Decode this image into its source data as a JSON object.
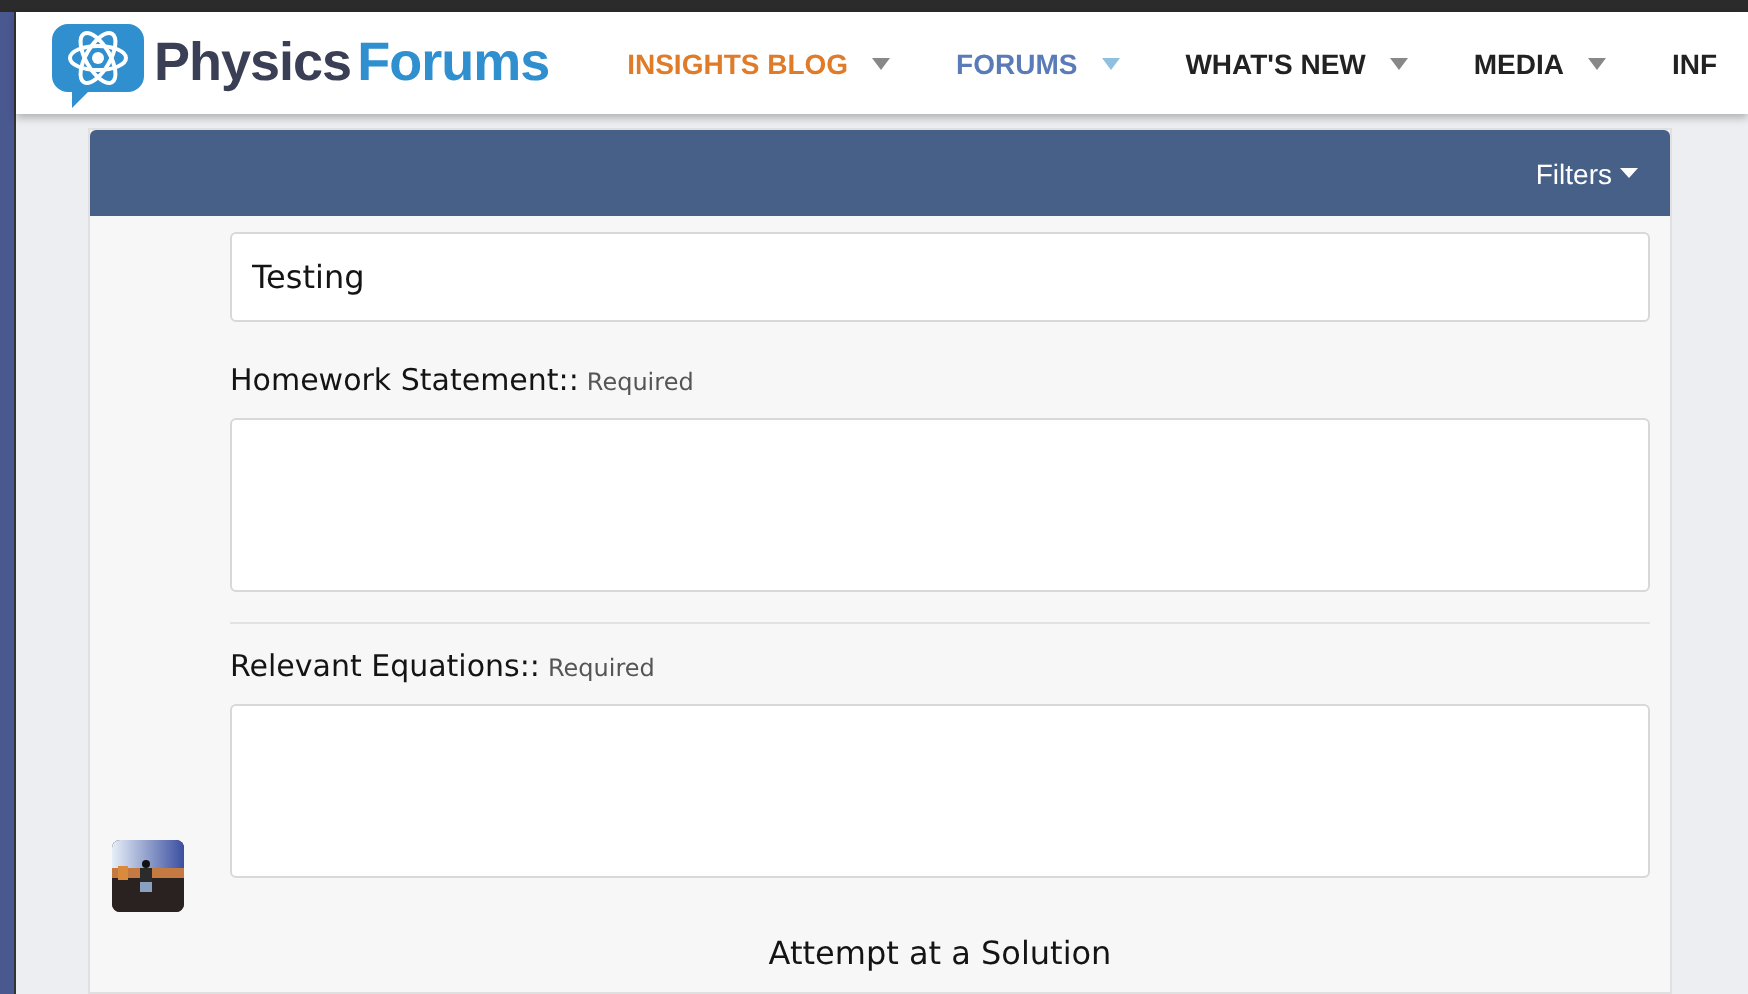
{
  "header": {
    "logo": {
      "word_1": "Physics",
      "word_2": "Forums"
    },
    "nav": [
      {
        "label": "INSIGHTS BLOG",
        "color": "#e07b2a"
      },
      {
        "label": "FORUMS",
        "color": "#5b7bb8"
      },
      {
        "label": "WHAT'S NEW",
        "color": "#222222"
      },
      {
        "label": "MEDIA",
        "color": "#222222"
      },
      {
        "label": "INF",
        "color": "#222222"
      }
    ]
  },
  "filter_bar": {
    "label": "Filters"
  },
  "form": {
    "title_field": {
      "value": "Testing"
    },
    "fields": [
      {
        "label": "Homework Statement::",
        "hint": "Required"
      },
      {
        "label": "Relevant Equations::",
        "hint": "Required"
      }
    ],
    "next_section": "Attempt at a Solution"
  }
}
